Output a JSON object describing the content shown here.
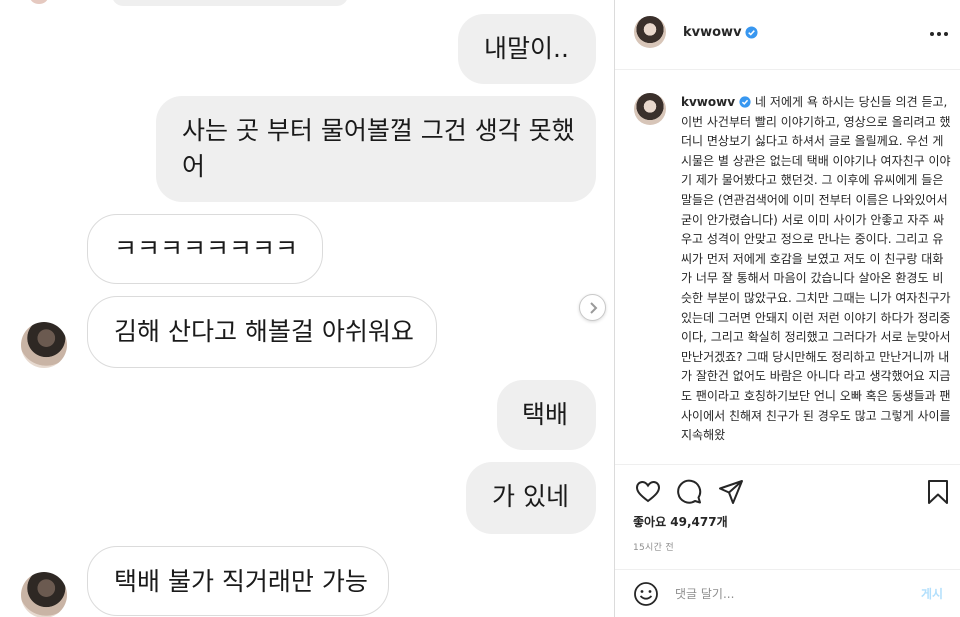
{
  "chat": {
    "messages": [
      {
        "side": "out",
        "lines": [
          "내말이.."
        ]
      },
      {
        "side": "out",
        "lines": [
          "사는 곳 부터 물어볼껄 그건 생각 못했",
          "어"
        ]
      },
      {
        "side": "in",
        "lines": [
          "ㅋㅋㅋㅋㅋㅋㅋㅋ"
        ]
      },
      {
        "side": "in",
        "lines": [
          "김해 산다고 해볼걸 아쉬워요"
        ]
      },
      {
        "side": "out",
        "lines": [
          "택배"
        ]
      },
      {
        "side": "out",
        "lines": [
          "가 있네"
        ]
      },
      {
        "side": "in",
        "lines": [
          "택배 불가 직거래만 가능"
        ]
      }
    ]
  },
  "post": {
    "username": "kvwowv",
    "verified": true,
    "caption": "네 저에게 욕 하시는 당신들 의견 듣고,이번 사건부터 빨리 이야기하고, 영상으로 올리려고 했더니 면상보기 싫다고 하셔서 글로 올릴께요. 우선 게시물은 별 상관은 없는데 택배 이야기나 여자친구 이야기 제가 물어봤다고 했던것. 그 이후에 유씨에게 들은 말들은 (연관검색어에 이미 전부터 이름은 나와있어서 굳이 안가렸습니다) 서로 이미 사이가 안좋고 자주 싸우고 성격이 안맞고 정으로 만나는 중이다. 그리고 유씨가 먼저 저에게 호감을 보였고 저도 이 친구랑 대화가 너무 잘 통해서 마음이 갔습니다 살아온 환경도 비슷한 부분이 많았구요. 그치만 그때는 니가 여자친구가 있는데 그러면 안돼지 이런 저런 이야기 하다가 정리중이다, 그리고 확실히 정리했고 그러다가 서로 눈맞아서 만난거겠죠? 그때 당시만해도 정리하고 만난거니까 내가 잘한건 없어도 바람은 아니다 라고 생각했어요 지금도 팬이라고 호칭하기보단 언니 오빠 혹은 동생들과 팬 사이에서 친해져 친구가 된 경우도 많고 그렇게 사이를 지속해왔",
    "likes": "좋아요 49,477개",
    "timestamp": "15시간 전",
    "comment_placeholder": "댓글 달기...",
    "post_label": "게시"
  },
  "colors": {
    "verified": "#3897f0",
    "post_button": "#b2dffc"
  },
  "icons": [
    "heart-icon",
    "comment-icon",
    "share-icon",
    "bookmark-icon",
    "more-icon",
    "emoji-icon",
    "chevron-right-icon",
    "verified-badge-icon"
  ]
}
